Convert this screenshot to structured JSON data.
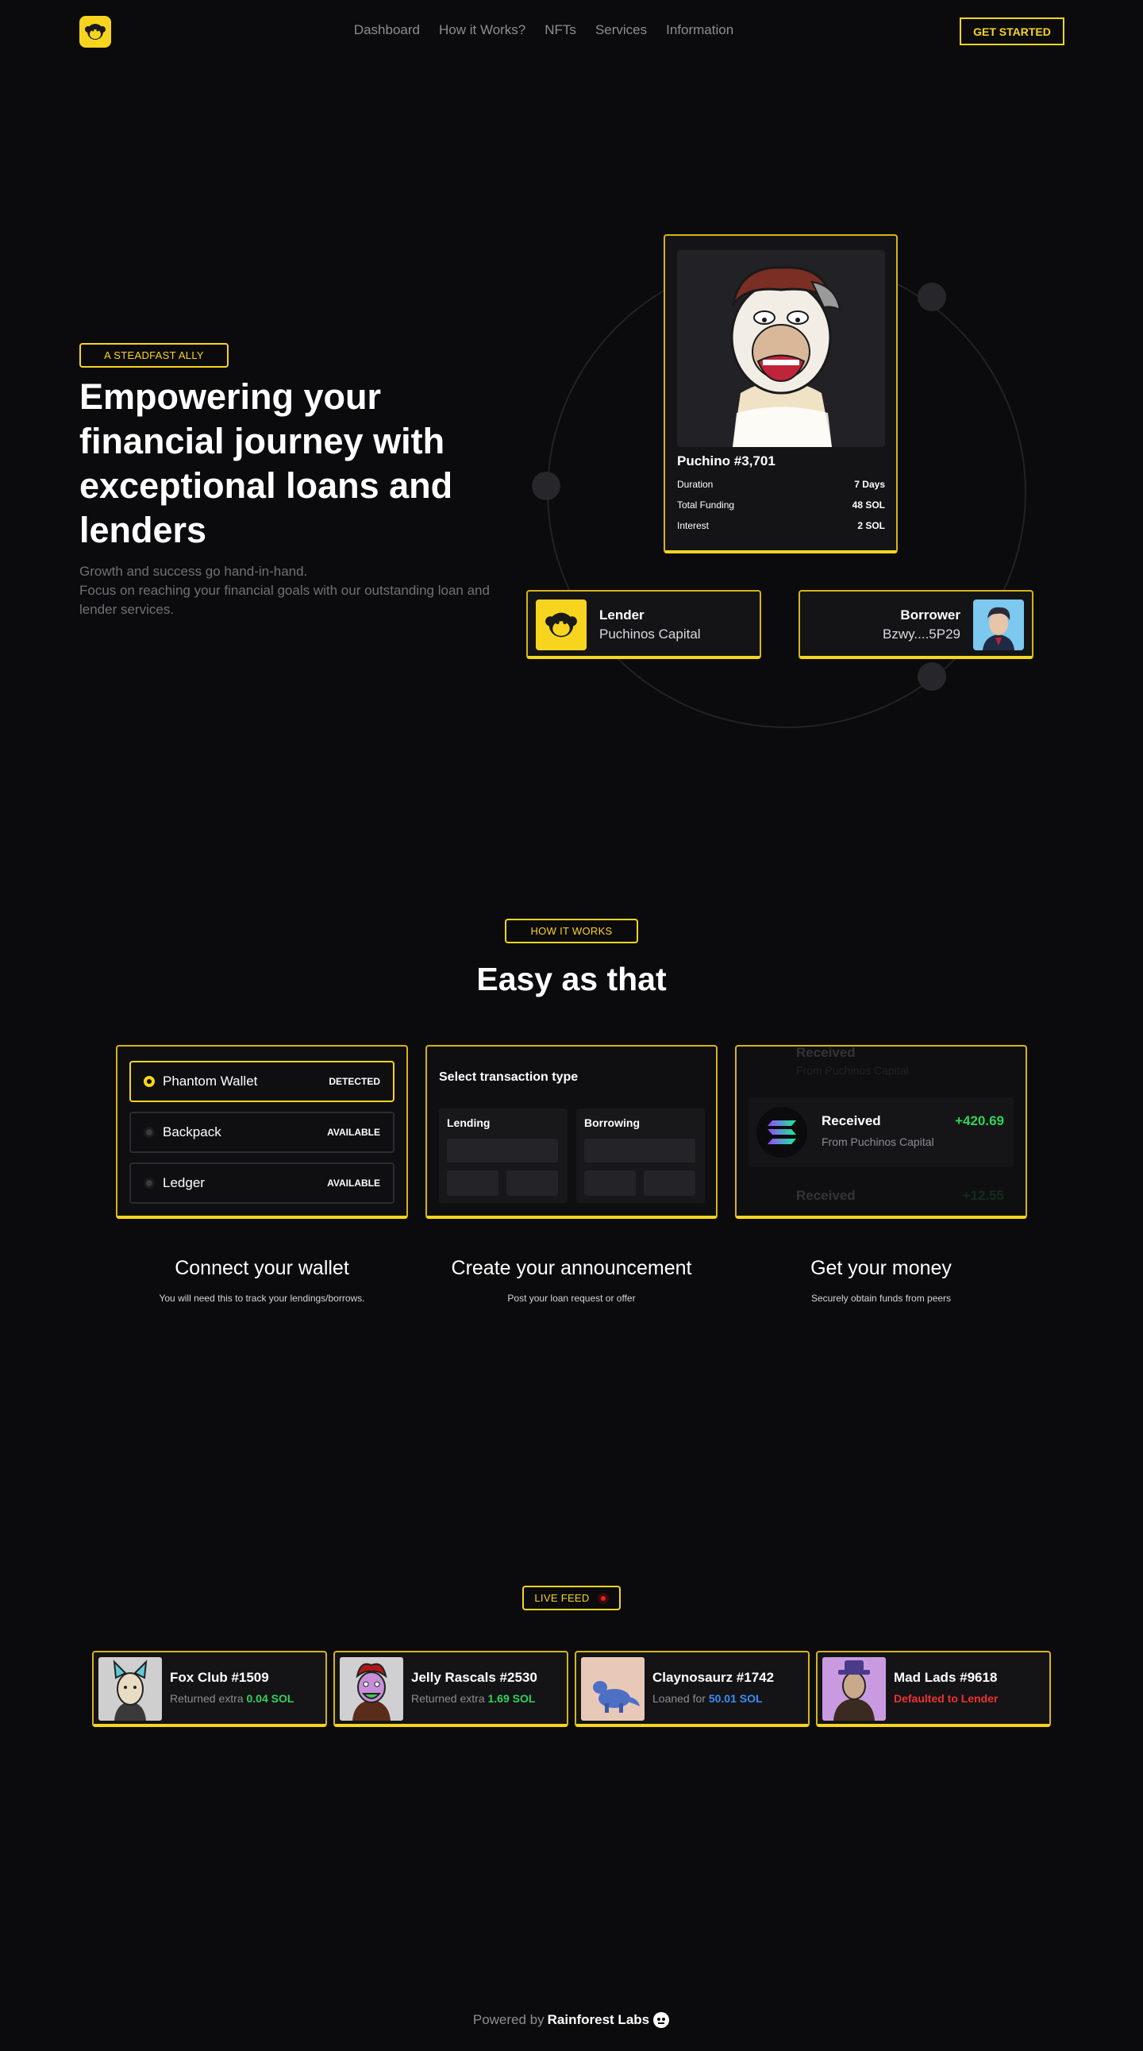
{
  "nav": {
    "items": [
      "Dashboard",
      "How it Works?",
      "NFTs",
      "Services",
      "Information"
    ],
    "cta": "GET STARTED"
  },
  "hero": {
    "badge": "A STEADFAST ALLY",
    "title": "Empowering your financial journey with exceptional loans and lenders",
    "subtitle_line1": "Growth and success go hand-in-hand.",
    "subtitle_line2": "Focus on reaching your financial goals with our outstanding loan and lender services.",
    "nft": {
      "name": "Puchino #3,701",
      "rows": [
        {
          "label": "Duration",
          "value": "7 Days"
        },
        {
          "label": "Total Funding",
          "value": "48 SOL"
        },
        {
          "label": "Interest",
          "value": "2 SOL"
        }
      ]
    },
    "lender": {
      "title": "Lender",
      "name": "Puchinos Capital"
    },
    "borrower": {
      "title": "Borrower",
      "name": "Bzwy....5P29"
    }
  },
  "how": {
    "badge": "HOW IT WORKS",
    "title": "Easy as that",
    "wallets": [
      {
        "name": "Phantom Wallet",
        "status": "DETECTED"
      },
      {
        "name": "Backpack",
        "status": "AVAILABLE"
      },
      {
        "name": "Ledger",
        "status": "AVAILABLE"
      }
    ],
    "tx": {
      "title": "Select transaction type",
      "lending": "Lending",
      "borrowing": "Borrowing"
    },
    "received": {
      "title": "Received",
      "amount": "+420.69",
      "from": "From Puchinos Capital",
      "amount_below": "+12.55"
    },
    "steps": [
      {
        "title": "Connect your wallet",
        "desc": "You will need this to track your lendings/borrows."
      },
      {
        "title": "Create your announcement",
        "desc": "Post your loan request or offer"
      },
      {
        "title": "Get your money",
        "desc": "Securely obtain funds from peers"
      }
    ]
  },
  "live": {
    "badge": "LIVE FEED",
    "items": [
      {
        "name": "Fox Club #1509",
        "prefix": "Returned extra ",
        "value": "0.04 SOL",
        "color": "#2fd35a"
      },
      {
        "name": "Jelly Rascals #2530",
        "prefix": "Returned extra ",
        "value": "1.69 SOL",
        "color": "#2fd35a"
      },
      {
        "name": "Claynosaurz #1742",
        "prefix": "Loaned for ",
        "value": "50.01 SOL",
        "color": "#3b8ef7"
      },
      {
        "name": "Mad Lads #9618",
        "prefix": "",
        "value": "Defaulted to Lender",
        "color": "#f13030"
      }
    ]
  },
  "footer": {
    "prefix": "Powered by ",
    "brand": "Rainforest Labs"
  },
  "colors": {
    "accent": "#f7d51f",
    "background": "#0b0b0d",
    "card": "#141417"
  }
}
